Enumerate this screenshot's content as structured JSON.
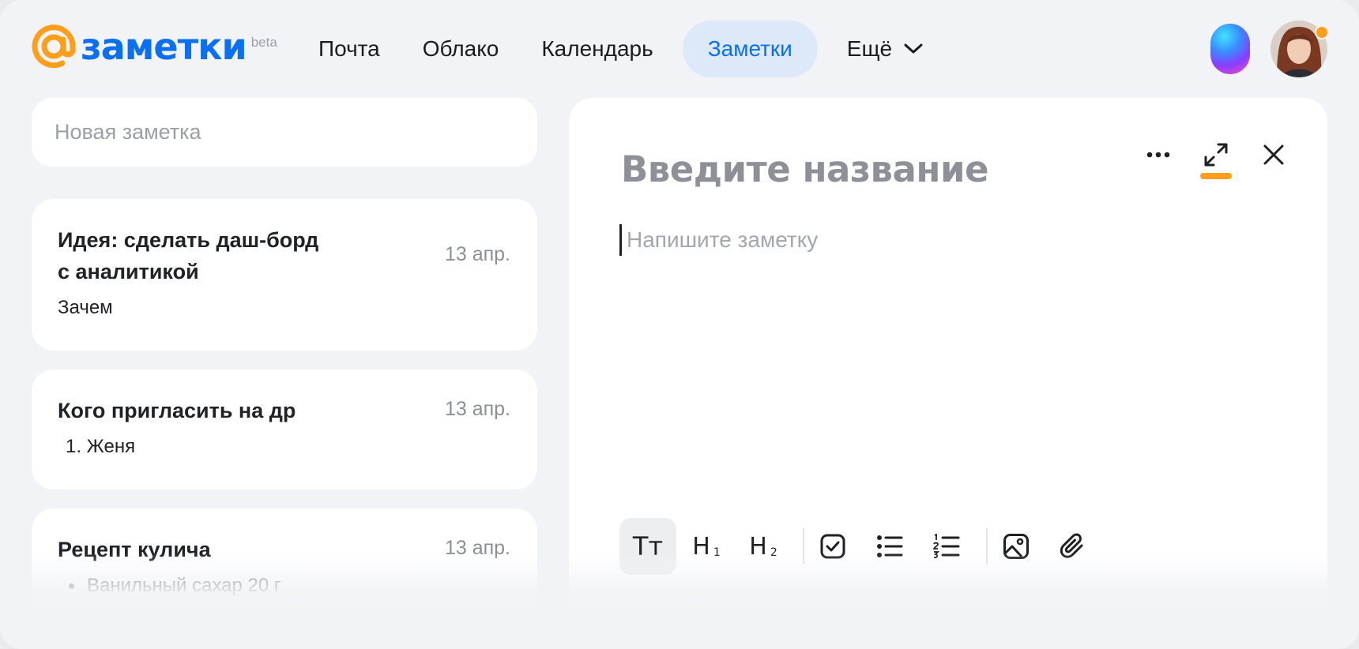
{
  "app": {
    "logo_text": "заметки",
    "logo_badge": "beta"
  },
  "nav": {
    "items": [
      {
        "label": "Почта"
      },
      {
        "label": "Облако"
      },
      {
        "label": "Календарь"
      },
      {
        "label": "Заметки",
        "active": true
      }
    ],
    "more_label": "Ещё"
  },
  "sidebar": {
    "new_note_placeholder": "Новая заметка",
    "notes": [
      {
        "title_line1": "Идея: сделать даш-борд",
        "title_line2": "с аналитикой",
        "preview": "Зачем",
        "date": "13 апр."
      },
      {
        "title": "Кого пригласить на др",
        "preview": "1. Женя",
        "date": "13 апр."
      },
      {
        "title": "Рецепт кулича",
        "preview": "Ванильный сахар 20 г",
        "date": "13 апр."
      }
    ]
  },
  "editor": {
    "title_placeholder": "Введите название",
    "body_placeholder": "Напишите заметку",
    "toolbar": {
      "text_style": "Тт",
      "h1": "H",
      "h1_sub": "1",
      "h2": "H",
      "h2_sub": "2"
    }
  },
  "colors": {
    "accent": "#0a6ff0",
    "accent_bg": "#dde8f8",
    "orange": "#ff9e1b",
    "page_bg": "#f2f3f6"
  },
  "icons": [
    "mail-at-logo-icon",
    "chevron-down-icon",
    "assistant-orb-icon",
    "avatar",
    "more-dots-icon",
    "expand-icon",
    "close-icon",
    "checkbox-icon",
    "bullet-list-icon",
    "numbered-list-icon",
    "image-icon",
    "attachment-icon"
  ]
}
